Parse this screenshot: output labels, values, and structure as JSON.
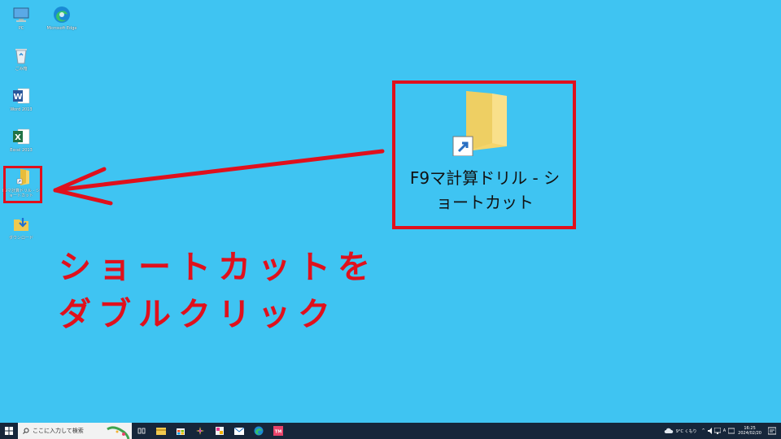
{
  "desktop": {
    "icons": [
      {
        "label": "PC",
        "icon": "pc-icon"
      },
      {
        "label": "Microsoft Edge",
        "icon": "edge-icon"
      },
      {
        "label": "ごみ箱",
        "icon": "recycle-bin-icon"
      },
      {
        "label": "Word 2013",
        "icon": "word-icon"
      },
      {
        "label": "Excel 2013",
        "icon": "excel-icon"
      },
      {
        "label": "F9マ計算ドリル - ショートカット",
        "icon": "folder-shortcut-icon"
      },
      {
        "label": "ダウンロード",
        "icon": "download-folder-icon"
      }
    ],
    "callout_label_line1": "F9マ計算ドリル - シ",
    "callout_label_line2": "ョートカット",
    "instruction_line1": "ショートカットを",
    "instruction_line2": "ダブルクリック",
    "highlight_color": "#e0101c",
    "background_color": "#3fc4f2"
  },
  "taskbar": {
    "search_placeholder": "ここに入力して検索",
    "weather": "9°C くもり",
    "ime": "A",
    "time": "16:25",
    "date": "2024/02/20"
  }
}
